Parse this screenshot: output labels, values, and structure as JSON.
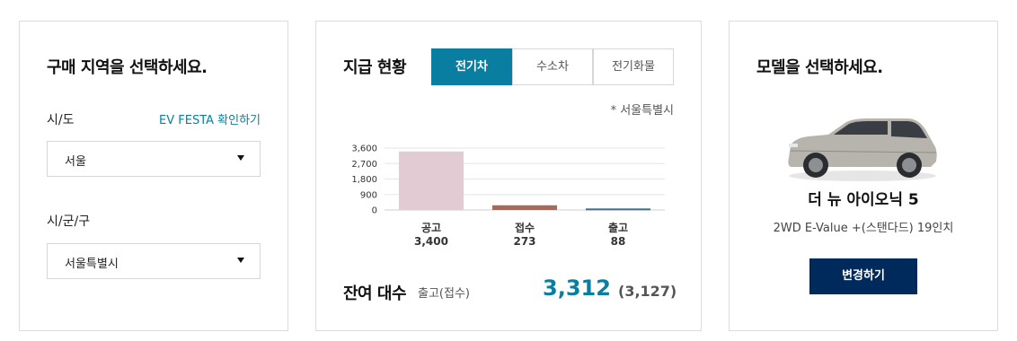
{
  "region_card": {
    "title": "구매 지역을 선택하세요.",
    "sido_label": "시/도",
    "ev_festa_link": "EV FESTA 확인하기",
    "sido_value": "서울",
    "sigungu_label": "시/군/구",
    "sigungu_value": "서울특별시"
  },
  "status_card": {
    "title": "지급 현황",
    "tabs": [
      {
        "label": "전기차",
        "active": true
      },
      {
        "label": "수소차",
        "active": false
      },
      {
        "label": "전기화물",
        "active": false
      }
    ],
    "region_note": "* 서울특별시",
    "remain_label": "잔여 대수",
    "remain_sub": "출고(접수)",
    "remain_value": "3,312",
    "remain_paren": "(3,127)"
  },
  "chart_data": {
    "type": "bar",
    "categories": [
      "공고",
      "접수",
      "출고"
    ],
    "value_labels": [
      "3,400",
      "273",
      "88"
    ],
    "values": [
      3400,
      273,
      88
    ],
    "colors": [
      "#e3cbd3",
      "#a86a56",
      "#3d6e8c"
    ],
    "ylim": [
      0,
      3600
    ],
    "yticks": [
      0,
      900,
      1800,
      2700,
      3600
    ],
    "ytick_labels": [
      "0",
      "900",
      "1,800",
      "2,700",
      "3,600"
    ],
    "grid": true
  },
  "model_card": {
    "title": "모델을 선택하세요.",
    "car_icon": "car-image",
    "model_name": "더 뉴 아이오닉 5",
    "model_trim": "2WD E-Value +(스탠다드) 19인치",
    "change_button": "변경하기"
  }
}
